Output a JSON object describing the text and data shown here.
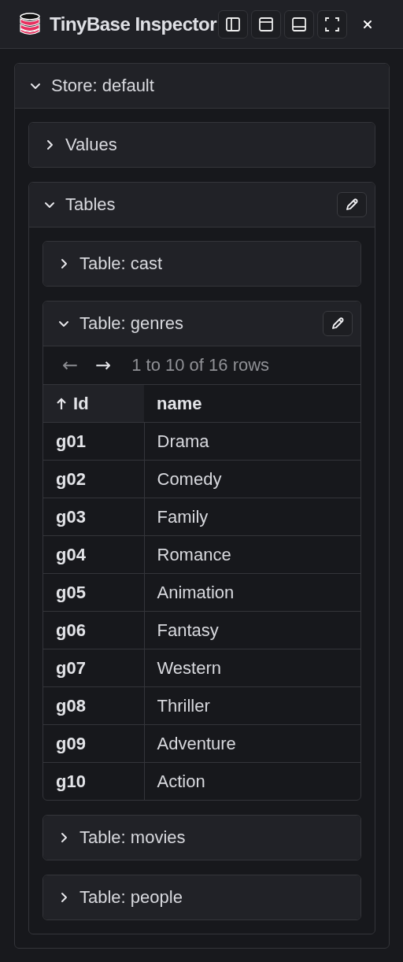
{
  "header": {
    "title": "TinyBase Inspector"
  },
  "store": {
    "title": "Store: default",
    "expanded": true,
    "sections": [
      {
        "title": "Values",
        "expanded": false,
        "editable": false
      },
      {
        "title": "Tables",
        "expanded": true,
        "editable": true,
        "tables": [
          {
            "title": "Table: cast",
            "expanded": false,
            "editable": false
          },
          {
            "title": "Table: genres",
            "expanded": true,
            "editable": true,
            "prev": "←",
            "next": "→",
            "pagination": "1 to 10 of 16 rows",
            "columns": [
              {
                "label": "Id",
                "sorted": true
              },
              {
                "label": "name",
                "sorted": false
              }
            ],
            "rows": [
              {
                "id": "g01",
                "name": "Drama"
              },
              {
                "id": "g02",
                "name": "Comedy"
              },
              {
                "id": "g03",
                "name": "Family"
              },
              {
                "id": "g04",
                "name": "Romance"
              },
              {
                "id": "g05",
                "name": "Animation"
              },
              {
                "id": "g06",
                "name": "Fantasy"
              },
              {
                "id": "g07",
                "name": "Western"
              },
              {
                "id": "g08",
                "name": "Thriller"
              },
              {
                "id": "g09",
                "name": "Adventure"
              },
              {
                "id": "g10",
                "name": "Action"
              }
            ]
          },
          {
            "title": "Table: movies",
            "expanded": false,
            "editable": false
          },
          {
            "title": "Table: people",
            "expanded": false,
            "editable": false
          }
        ]
      }
    ]
  }
}
